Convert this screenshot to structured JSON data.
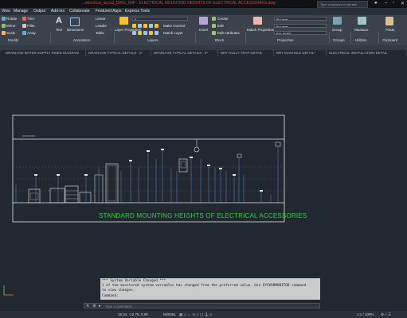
{
  "window": {
    "title": "...electrical_layout_DWG_WIP - ELECTRICAL MOUNTING HEIGHTS OF ELECTRICAL ACCESSORIES.dwg",
    "search_placeholder": "Type a keyword or phrase"
  },
  "menu": [
    "View",
    "Manage",
    "Output",
    "Add-ins",
    "Collaborate",
    "Featured Apps",
    "Express Tools"
  ],
  "ribbon": {
    "modify": {
      "label": "Modify",
      "items": [
        "Rotate",
        "Trim",
        "Mirror",
        "Fillet",
        "Scale",
        "Array"
      ]
    },
    "annotation": {
      "label": "Annotation",
      "items": [
        "Text",
        "Dimension",
        "Linear",
        "Leader",
        "Table"
      ]
    },
    "layers": {
      "label": "Layers",
      "layer_properties": "Layer Properties",
      "current_layer": "0",
      "make_current": "Make Current",
      "match_layer": "Match Layer"
    },
    "block": {
      "label": "Block",
      "insert": "Insert",
      "create": "Create",
      "edit": "Edit",
      "edit_attributes": "Edit Attributes"
    },
    "properties": {
      "label": "Properties",
      "match_properties": "Match Properties",
      "color": "ByLayer",
      "linetype": "ByLayer",
      "lineweight": "BYLAYER"
    },
    "groups": {
      "label": "Groups",
      "group": "Group"
    },
    "utilities": {
      "label": "Utilities",
      "measure": "Measure"
    },
    "clipboard": {
      "label": "Clipboard",
      "paste": "Paste"
    }
  },
  "tabs": [
    "DRAINAGE WATER SUPPLY RISER DIAGRAM",
    "DRAINAGE TYPICAL DETAILS - 1*",
    "DRAINAGE TYPICAL DETAILS - 2*",
    "DRY GULLY TRAP DETAIL",
    "DRY MANHOLE DETAIL*",
    "ELECTRICAL INSTALLATION DETAIL"
  ],
  "drawing": {
    "title": "STANDARD MOUNTING HEIGHTS OF ELECTRICAL ACCESSORIES",
    "accent_color": "#2ecc40"
  },
  "command": {
    "history": [
      "*** System Variable Changed ***",
      "1 of the monitored system variables has changed from the preferred value. Use SYSVARMONITOR command",
      "to view changes.",
      "Command:"
    ],
    "placeholder": "Type a command"
  },
  "status": {
    "coords": "15.04, -12.78, 0.00",
    "mode": "MODEL",
    "scale": "1:1 / 100%"
  }
}
